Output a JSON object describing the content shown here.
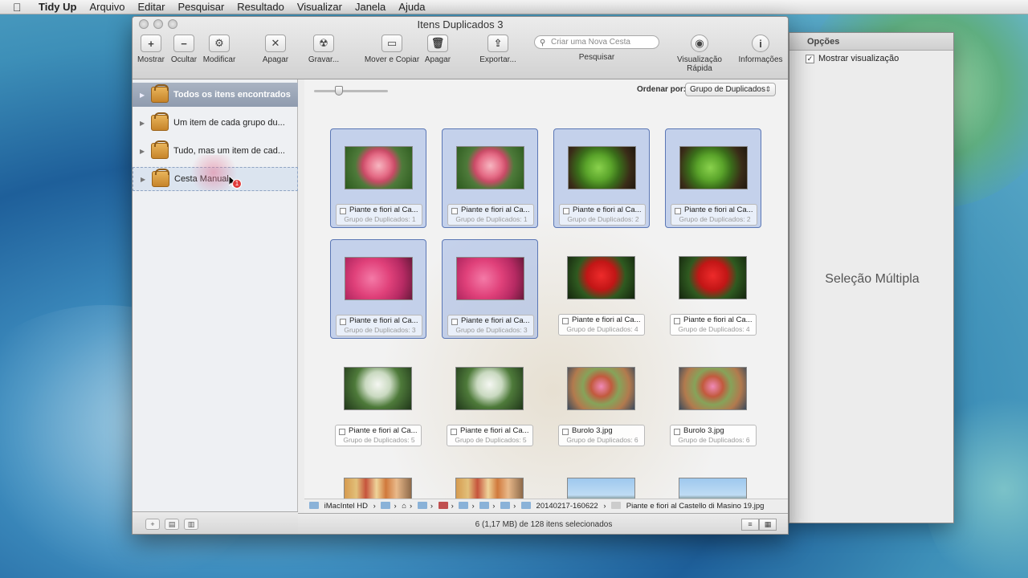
{
  "menubar": {
    "app": "Tidy Up",
    "items": [
      "Arquivo",
      "Editar",
      "Pesquisar",
      "Resultado",
      "Visualizar",
      "Janela",
      "Ajuda"
    ]
  },
  "window": {
    "title": "Itens Duplicados 3",
    "toolbar": {
      "mostrar": "Mostrar",
      "ocultar": "Ocultar",
      "modificar": "Modificar",
      "apagar1": "Apagar",
      "gravar": "Gravar...",
      "mover": "Mover e Copiar",
      "apagar2": "Apagar",
      "exportar": "Exportar...",
      "search_placeholder": "Criar uma Nova Cesta",
      "pesquisar": "Pesquisar",
      "visualizacao": "Visualização Rápida",
      "informacoes": "Informações"
    }
  },
  "sidebar": {
    "items": [
      {
        "label": "Todos os itens encontrados"
      },
      {
        "label": "Um item de cada grupo du..."
      },
      {
        "label": "Tudo, mas um item de cad..."
      },
      {
        "label": "Cesta Manual"
      }
    ],
    "drag_badge": "1"
  },
  "content": {
    "sort_label": "Ordenar por:",
    "sort_value": "Grupo de Duplicados",
    "tiles": [
      {
        "name": "Piante e fiori al Ca...",
        "group": "Grupo de Duplicados: 1"
      },
      {
        "name": "Piante e fiori al Ca...",
        "group": "Grupo de Duplicados: 1"
      },
      {
        "name": "Piante e fiori al Ca...",
        "group": "Grupo de Duplicados: 2"
      },
      {
        "name": "Piante e fiori al Ca...",
        "group": "Grupo de Duplicados: 2"
      },
      {
        "name": "Piante e fiori al Ca...",
        "group": "Grupo de Duplicados: 3"
      },
      {
        "name": "Piante e fiori al Ca...",
        "group": "Grupo de Duplicados: 3"
      },
      {
        "name": "Piante e fiori al Ca...",
        "group": "Grupo de Duplicados: 4"
      },
      {
        "name": "Piante e fiori al Ca...",
        "group": "Grupo de Duplicados: 4"
      },
      {
        "name": "Piante e fiori al Ca...",
        "group": "Grupo de Duplicados: 5"
      },
      {
        "name": "Piante e fiori al Ca...",
        "group": "Grupo de Duplicados: 5"
      },
      {
        "name": "Burolo 3.jpg",
        "group": "Grupo de Duplicados: 6"
      },
      {
        "name": "Burolo 3.jpg",
        "group": "Grupo de Duplicados: 6"
      }
    ],
    "path": {
      "disk": "iMacIntel HD",
      "folder": "20140217-160622",
      "file": "Piante e fiori al Castello di Masino 19.jpg"
    },
    "status": "6 (1,17 MB) de 128 itens selecionados"
  },
  "options": {
    "header": "Opções",
    "show_preview": "Mostrar visualização",
    "multi": "Seleção Múltipla"
  }
}
